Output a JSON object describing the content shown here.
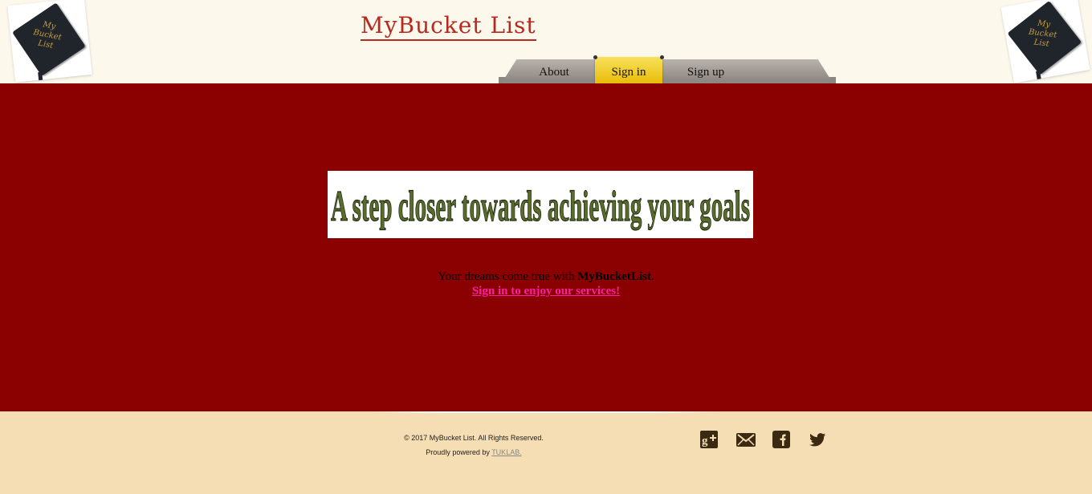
{
  "header": {
    "site_title": "MyBucket List",
    "logo_text": [
      "My",
      "Bucket",
      "List"
    ],
    "nav": {
      "about": "About",
      "sign_in": "Sign in",
      "sign_up": "Sign up",
      "active": "sign_in"
    }
  },
  "main": {
    "banner_text": "A step closer towards achieving your goals",
    "tagline_prefix": "Your dreams come true with ",
    "tagline_brand": "MyBucketList",
    "tagline_suffix": ".",
    "cta_link": "Sign in to enjoy our services!"
  },
  "footer": {
    "copyright": "© 2017 MyBucket List. All Rights Reserved.",
    "powered_by_prefix": "Proudly powered by ",
    "powered_by_link": "TUKLAB.",
    "social": [
      "google-plus-icon",
      "mail-icon",
      "facebook-icon",
      "twitter-icon"
    ]
  },
  "colors": {
    "header_bg": "#fdf8ec",
    "main_bg": "#8b0000",
    "footer_bg": "#f5deb3",
    "title": "#b8281e",
    "active_tab": "#f0c419",
    "cta_link": "#ff1aa8",
    "banner_text": "#5a6b2e",
    "icon": "#3a2a12"
  }
}
